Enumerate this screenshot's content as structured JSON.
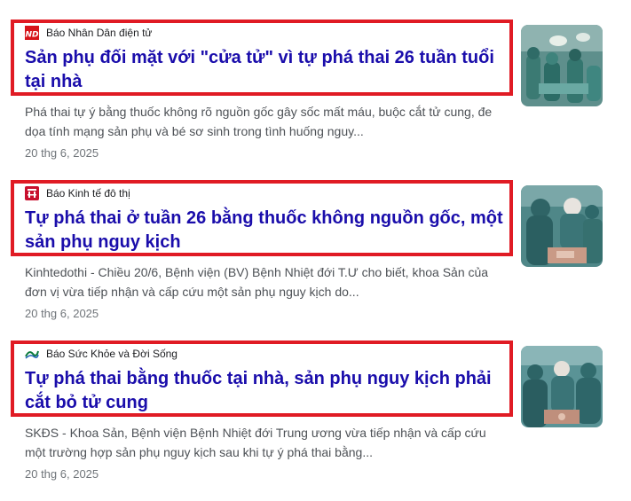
{
  "results": [
    {
      "source": "Báo Nhân Dân điện tử",
      "source_icon": "nhan-dan-logo-icon",
      "source_logo_text": "ND",
      "title": "Sản phụ đối mặt với \"cửa tử\" vì tự phá thai 26 tuần tuổi tại nhà",
      "snippet": "Phá thai tự ý bằng thuốc không rõ nguồn gốc gây sốc mất máu, buộc cắt tử cung, đe dọa tính mạng sản phụ và bé sơ sinh trong tình huống nguy...",
      "date": "20 thg 6, 2025",
      "thumbnail": "surgery-room-photo"
    },
    {
      "source": "Báo Kinh tế đô thị",
      "source_icon": "kinh-te-do-thi-logo-icon",
      "title": "Tự phá thai ở tuần 26 bằng thuốc không nguồn gốc, một sản phụ nguy kịch",
      "snippet": "Kinhtedothi - Chiều 20/6, Bệnh viện (BV) Bệnh Nhiệt đới T.Ư cho biết, khoa Sản của đơn vị vừa tiếp nhận và cấp cứu một sản phụ nguy kịch do...",
      "date": "20 thg 6, 2025",
      "thumbnail": "surgeons-operating-photo"
    },
    {
      "source": "Báo Sức Khỏe và Đời Sống",
      "source_icon": "suc-khoe-doi-song-logo-icon",
      "title": "Tự phá thai bằng thuốc tại nhà, sản phụ nguy kịch phải cắt bỏ tử cung",
      "snippet": "SKĐS - Khoa Sản, Bệnh viện Bệnh Nhiệt đới Trung ương vừa tiếp nhận và cấp cứu một trường hợp sản phụ nguy kịch sau khi tự ý phá thai bằng...",
      "date": "20 thg 6, 2025",
      "thumbnail": "surgery-team-photo"
    }
  ],
  "colors": {
    "link": "#1a0dab",
    "highlight_border": "#e01b24",
    "snippet": "#4d5156",
    "date": "#70757a"
  }
}
